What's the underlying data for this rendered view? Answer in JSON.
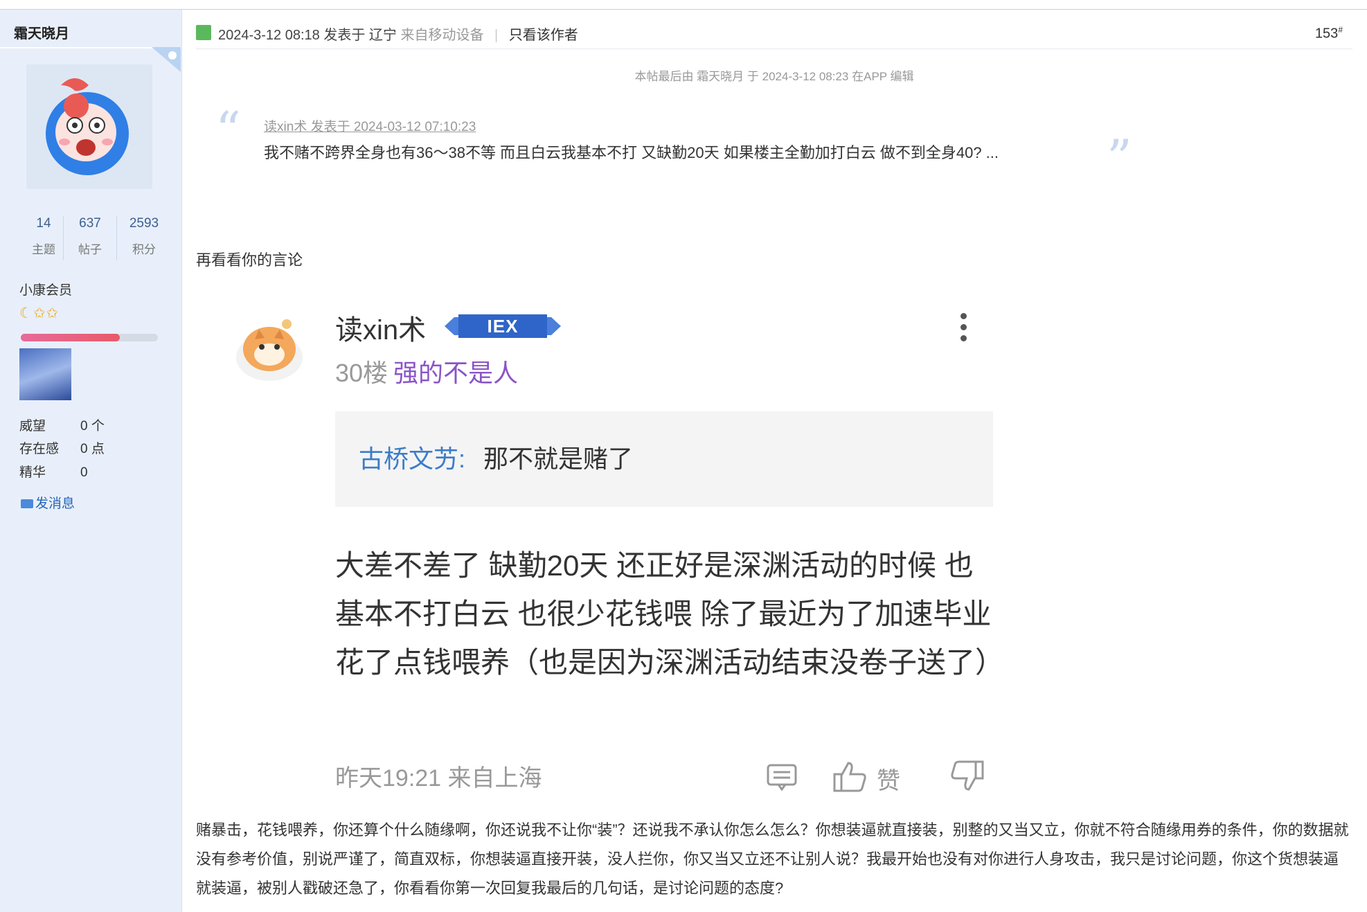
{
  "sidebar": {
    "author_name": "霜天晓月",
    "stats": [
      {
        "value": "14",
        "label": "主题"
      },
      {
        "value": "637",
        "label": "帖子"
      },
      {
        "value": "2593",
        "label": "积分"
      }
    ],
    "member_title": "小康会员",
    "stars": "☾✩✩",
    "level_progress": 0.72,
    "info": [
      {
        "key": "威望",
        "value": "0 个"
      },
      {
        "key": "存在感",
        "value": "0 点"
      },
      {
        "key": "精华",
        "value": "0"
      }
    ],
    "message_link": "发消息"
  },
  "post": {
    "datetime": "2024-3-12 08:18 发表于 辽宁",
    "device": "来自移动设备",
    "separator": "|",
    "only_author": "只看该作者",
    "floor": "153",
    "floor_mark": "#",
    "edit_note": "本帖最后由 霜天晓月 于 2024-3-12 08:23 在APP 编辑",
    "quote": {
      "author_line": "读xin术 发表于 2024-03-12 07:10:23",
      "text": "我不赌不跨界全身也有36～38不等  而且白云我基本不打 又缺勤20天   如果楼主全勤加打白云  做不到全身40?  ..."
    },
    "lead_text": "再看看你的言论",
    "screenshot": {
      "username": "读xin术",
      "badge": "IEX",
      "floor_label": "30楼",
      "floor_tag": "强的不是人",
      "reply_to": "古桥文艻:",
      "reply_text": "那不就是赌了",
      "body": "大差不差了  缺勤20天  还正好是深渊活动的时候  也基本不打白云  也很少花钱喂  除了最近为了加速毕业  花了点钱喂养（也是因为深渊活动结束没卷子送了）",
      "footer": "昨天19:21 来自上海",
      "like_label": "赞"
    },
    "closing_text": "赌暴击，花钱喂养，你还算个什么随缘啊，你还说我不让你“装”？还说我不承认你怎么怎么？你想装逼就直接装，别整的又当又立，你就不符合随缘用券的条件，你的数据就没有参考价值，别说严谨了，简直双标，你想装逼直接开装，没人拦你，你又当又立还不让别人说？我最开始也没有对你进行人身攻击，我只是讨论问题，你这个货想装逼就装逼，被别人戳破还急了，你看看你第一次回复我最后的几句话，是讨论问题的态度?"
  },
  "colors": {
    "sidebar_bg": "#e8effa",
    "link_blue": "#2366b8",
    "quote_mark": "#c9d7ee",
    "tag_purple": "#8a54c8",
    "reply_blue": "#3c7cc8",
    "progress": "#e85a6a"
  },
  "icons": [
    "post-status-icon",
    "mail-icon",
    "more-dots-icon",
    "comment-icon",
    "thumb-up-icon",
    "thumb-down-icon"
  ]
}
